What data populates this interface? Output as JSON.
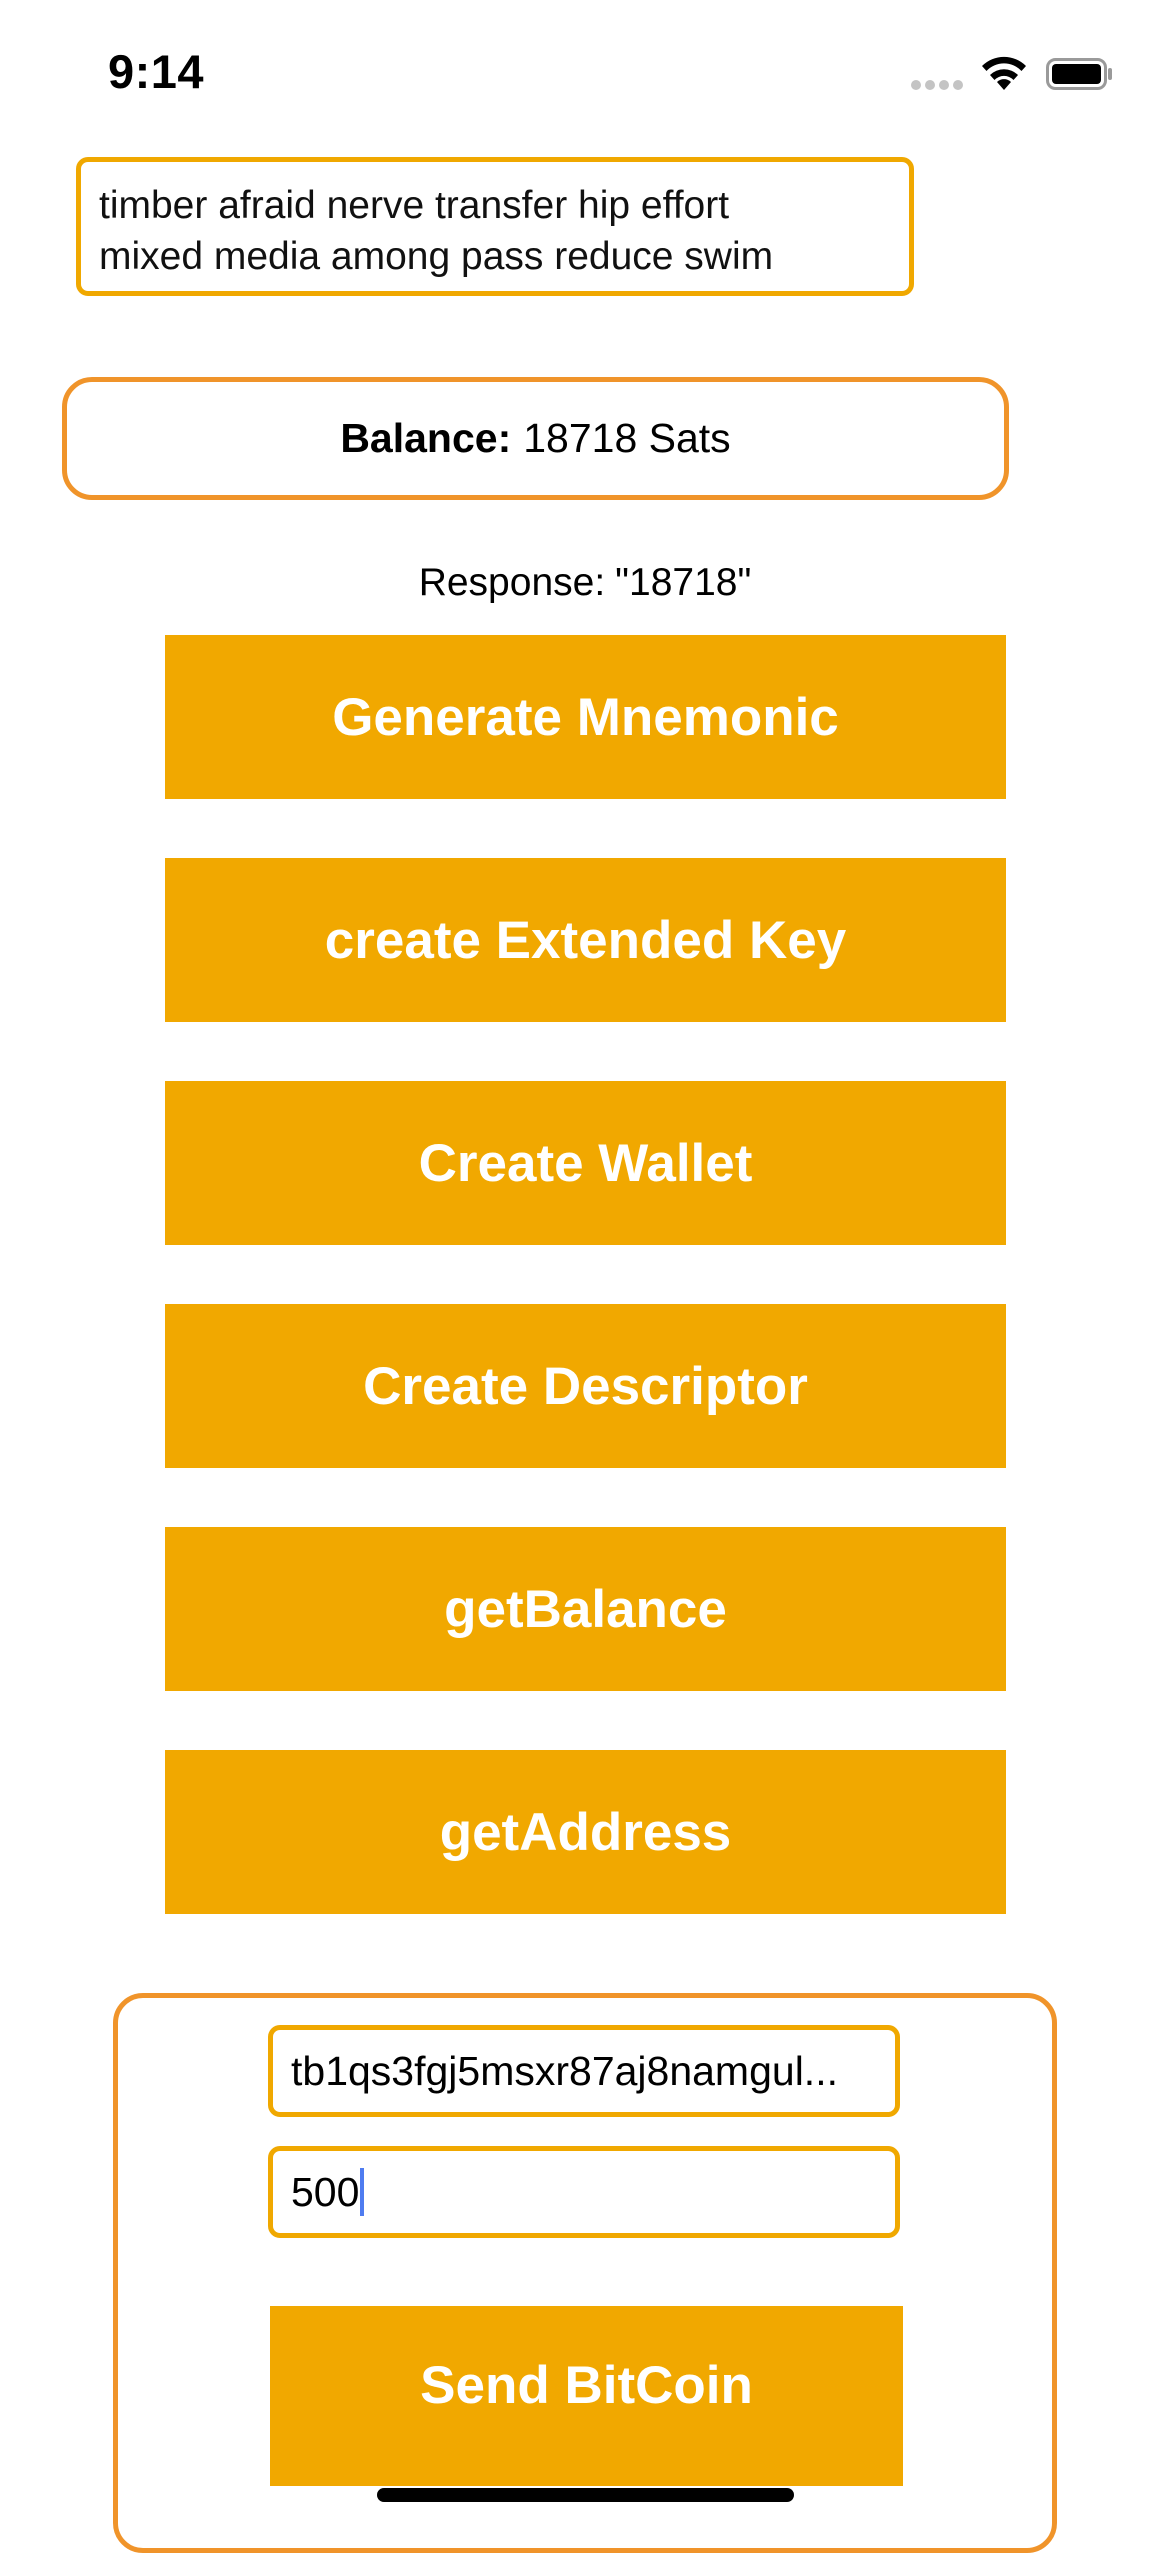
{
  "status_bar": {
    "time": "9:14"
  },
  "mnemonic": {
    "line1": "timber afraid nerve transfer hip effort",
    "line2": "mixed media among pass reduce swim"
  },
  "balance": {
    "label": "Balance:",
    "value": "18718 Sats"
  },
  "response": {
    "prefix": "Response:",
    "value": "\"18718\""
  },
  "buttons": [
    {
      "label": "Generate Mnemonic"
    },
    {
      "label": "create Extended Key"
    },
    {
      "label": "Create Wallet"
    },
    {
      "label": "Create Descriptor"
    },
    {
      "label": "getBalance"
    },
    {
      "label": "getAddress"
    }
  ],
  "send": {
    "address_value": "tb1qs3fgj5msxr87aj8namgul...",
    "amount_value": "500",
    "button_label": "Send BitCoin"
  },
  "colors": {
    "accent": "#f1a800",
    "border_orange": "#f0942a",
    "caret": "#4f7cf0"
  },
  "icons": [
    "cellular-signal-icon",
    "wifi-icon",
    "battery-icon"
  ]
}
